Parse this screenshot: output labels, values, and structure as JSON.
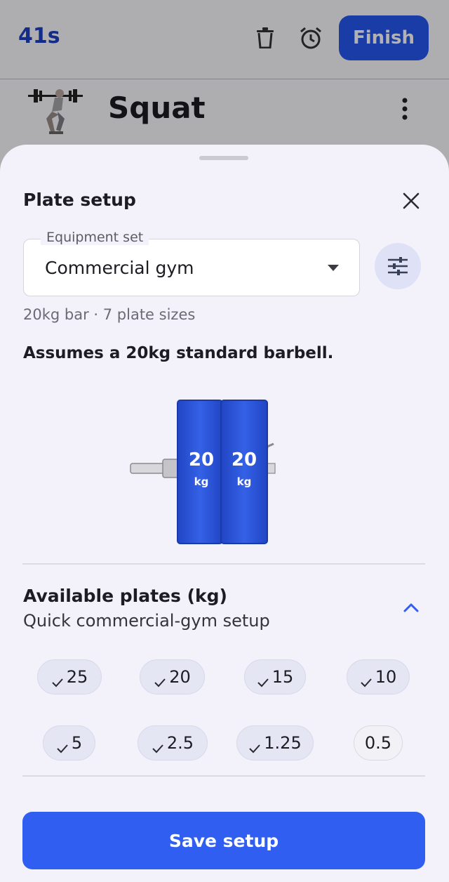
{
  "header": {
    "timer": "41s",
    "finish_label": "Finish"
  },
  "exercise": {
    "name": "Squat"
  },
  "sheet": {
    "title": "Plate setup",
    "equipment_label": "Equipment set",
    "equipment_value": "Commercial gym",
    "sub_info": "20kg bar · 7 plate sizes",
    "assumption": "Assumes a 20kg standard barbell.",
    "loaded_plates": [
      {
        "weight": "20",
        "unit": "kg"
      },
      {
        "weight": "20",
        "unit": "kg"
      }
    ],
    "available_title": "Available plates (kg)",
    "available_subtitle": "Quick commercial-gym setup",
    "plates": [
      {
        "label": "25",
        "selected": true
      },
      {
        "label": "20",
        "selected": true
      },
      {
        "label": "15",
        "selected": true
      },
      {
        "label": "10",
        "selected": true
      },
      {
        "label": "5",
        "selected": true
      },
      {
        "label": "2.5",
        "selected": true
      },
      {
        "label": "1.25",
        "selected": true
      },
      {
        "label": "0.5",
        "selected": false
      }
    ],
    "save_label": "Save setup"
  },
  "colors": {
    "accent": "#2f5ef1",
    "plate_blue": "#2a52d8",
    "chip_selected_bg": "#e4e6f4",
    "sheet_bg": "#f3f1f9"
  },
  "icons": [
    "trash-icon",
    "alarm-clock-icon",
    "more-vertical-icon",
    "close-icon",
    "dropdown-caret-icon",
    "tune-sliders-icon",
    "chevron-up-icon",
    "check-icon"
  ]
}
